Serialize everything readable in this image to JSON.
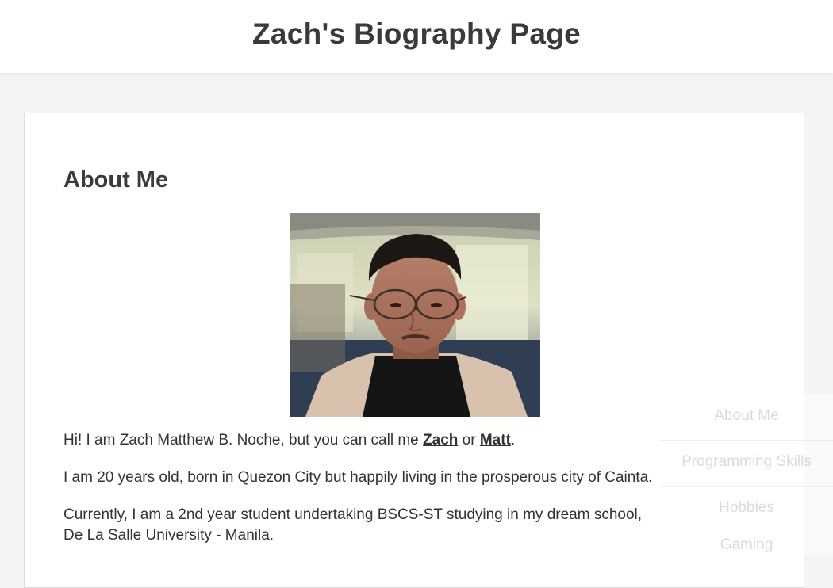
{
  "header": {
    "title": "Zach's Biography Page"
  },
  "about": {
    "heading": "About Me",
    "intro_prefix": "Hi! I am Zach Matthew B. Noche, but you can call me ",
    "nick1": "Zach",
    "intro_or": " or ",
    "nick2": "Matt",
    "intro_suffix": ".",
    "para2": "I am 20 years old, born in Quezon City but happily living in the prosperous city of Cainta.",
    "para3_line1": "Currently, I am a 2nd year student undertaking BSCS-ST studying in my dream school,",
    "para3_line2": "De La Salle University - Manila."
  },
  "side_nav": {
    "items": [
      {
        "label": "About Me"
      },
      {
        "label": "Programming Skills"
      },
      {
        "label": "Hobbies"
      },
      {
        "label": "Gaming"
      }
    ]
  }
}
